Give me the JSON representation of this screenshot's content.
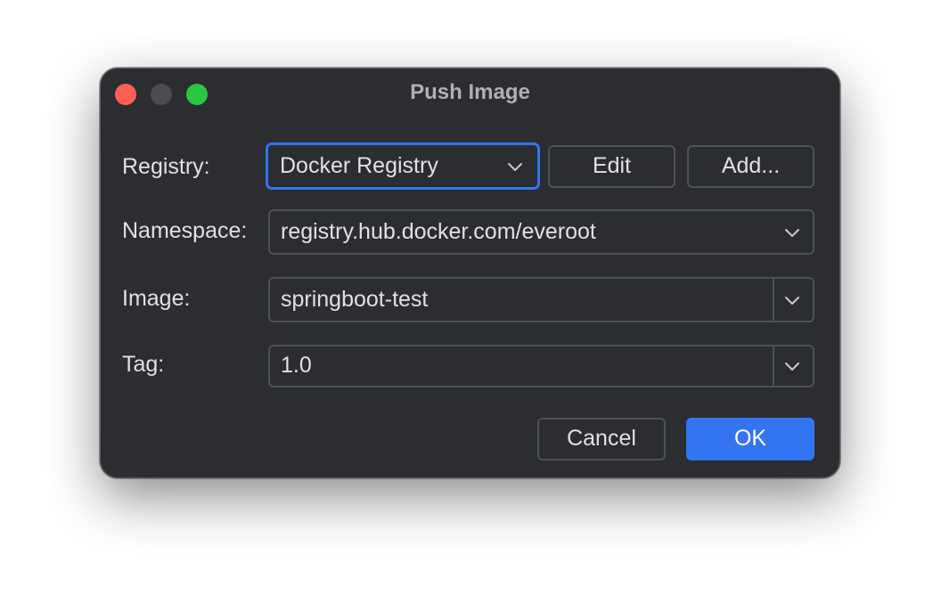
{
  "window": {
    "title": "Push Image"
  },
  "form": {
    "registry": {
      "label": "Registry:",
      "value": "Docker Registry",
      "edit_label": "Edit",
      "add_label": "Add..."
    },
    "namespace": {
      "label": "Namespace:",
      "value": "registry.hub.docker.com/everoot"
    },
    "image": {
      "label": "Image:",
      "value": "springboot-test"
    },
    "tag": {
      "label": "Tag:",
      "value": "1.0"
    }
  },
  "footer": {
    "cancel_label": "Cancel",
    "ok_label": "OK"
  },
  "colors": {
    "accent": "#3574f0",
    "background": "#2b2d30",
    "close": "#fe5f57",
    "minimize": "#4b4c4f",
    "maximize": "#28c840"
  },
  "icons": {
    "dropdown": "chevron-down-icon"
  }
}
